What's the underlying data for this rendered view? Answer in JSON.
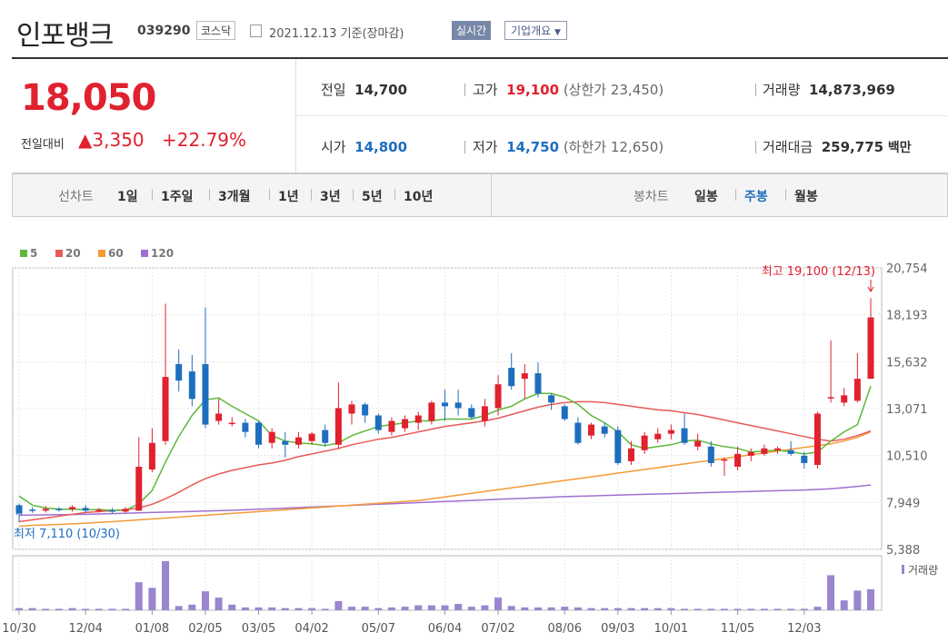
{
  "header": {
    "company": "인포뱅크",
    "code": "039290",
    "market": "코스닥",
    "date": "2021.12.13 기준(장마감)",
    "realtime": "실시간",
    "overview": "기업개요"
  },
  "quote": {
    "price": "18,050",
    "change_label": "전일대비",
    "change_value": "▲3,350",
    "change_pct": "+22.79%",
    "prev_label": "전일",
    "prev_value": "14,700",
    "high_label": "고가",
    "high_value": "19,100",
    "upper_label": "(상한가 23,450)",
    "vol_label": "거래량",
    "vol_value": "14,873,969",
    "open_label": "시가",
    "open_value": "14,800",
    "low_label": "저가",
    "low_value": "14,750",
    "lower_label": "(하한가 12,650)",
    "amt_label": "거래대금",
    "amt_value": "259,775",
    "amt_unit": "백만"
  },
  "tabs": {
    "line_label": "선차트",
    "periods": [
      "1일",
      "1주일",
      "3개월",
      "1년",
      "3년",
      "5년",
      "10년"
    ],
    "candle_label": "봉차트",
    "candles": [
      "일봉",
      "주봉",
      "월봉"
    ],
    "selected": "주봉"
  },
  "colors": {
    "up": "#e0212e",
    "down": "#1e6ebf",
    "ma5": "#5cb83a",
    "ma20": "#e85a58",
    "ma60": "#f59a35",
    "ma120": "#a070d0"
  },
  "chart_data": {
    "type": "candlestick",
    "legend": [
      {
        "name": "5",
        "color": "#5cb83a"
      },
      {
        "name": "20",
        "color": "#e85a58"
      },
      {
        "name": "60",
        "color": "#f59a35"
      },
      {
        "name": "120",
        "color": "#a070d0"
      }
    ],
    "y_ticks": [
      "20,754",
      "18,193",
      "15,632",
      "13,071",
      "10,510",
      "7,949",
      "5,388"
    ],
    "ylim": [
      5388,
      20754
    ],
    "x_ticks": [
      "10/30",
      "12/04",
      "01/08",
      "02/05",
      "03/05",
      "04/02",
      "05/07",
      "06/04",
      "07/02",
      "08/06",
      "09/03",
      "10/01",
      "11/05",
      "12/03"
    ],
    "annotation_high": "최고 19,100 (12/13)",
    "annotation_low": "최저 7,110 (10/30)",
    "volume_label": "거래량",
    "candles": [
      [
        7800,
        7350,
        7900,
        7110
      ],
      [
        7560,
        7500,
        7700,
        7380
      ],
      [
        7500,
        7600,
        7750,
        7400
      ],
      [
        7600,
        7550,
        7700,
        7450
      ],
      [
        7580,
        7700,
        7800,
        7450
      ],
      [
        7650,
        7500,
        7800,
        7400
      ],
      [
        7500,
        7560,
        7650,
        7400
      ],
      [
        7520,
        7450,
        7650,
        7350
      ],
      [
        7450,
        7600,
        7700,
        7400
      ],
      [
        7500,
        9900,
        11500,
        7500
      ],
      [
        9750,
        11200,
        12000,
        9600
      ],
      [
        11300,
        14800,
        18800,
        11100
      ],
      [
        15500,
        14600,
        16300,
        14000
      ],
      [
        15100,
        13600,
        16000,
        13200
      ],
      [
        15500,
        12200,
        18600,
        12000
      ],
      [
        12400,
        12800,
        13600,
        12200
      ],
      [
        12300,
        12300,
        12600,
        12100
      ],
      [
        12300,
        11800,
        12500,
        11500
      ],
      [
        12300,
        11100,
        12400,
        10900
      ],
      [
        11200,
        11800,
        12000,
        10900
      ],
      [
        11300,
        11100,
        11800,
        10400
      ],
      [
        11100,
        11500,
        11800,
        10900
      ],
      [
        11300,
        11700,
        11800,
        11100
      ],
      [
        11900,
        11200,
        12200,
        11000
      ],
      [
        11100,
        13100,
        14500,
        10900
      ],
      [
        12800,
        13300,
        13500,
        12200
      ],
      [
        13300,
        12700,
        13400,
        12300
      ],
      [
        12700,
        11900,
        12800,
        11700
      ],
      [
        11800,
        12400,
        12600,
        11600
      ],
      [
        12000,
        12500,
        12700,
        11800
      ],
      [
        12300,
        12700,
        12900,
        11900
      ],
      [
        12400,
        13400,
        13500,
        12200
      ],
      [
        13400,
        13200,
        14100,
        12400
      ],
      [
        13400,
        13100,
        14100,
        12700
      ],
      [
        13100,
        12600,
        13300,
        12500
      ],
      [
        12400,
        13200,
        13600,
        12100
      ],
      [
        13100,
        14400,
        14900,
        12700
      ],
      [
        15300,
        14300,
        16100,
        14100
      ],
      [
        14700,
        15000,
        15500,
        13600
      ],
      [
        15000,
        13900,
        15600,
        13700
      ],
      [
        13800,
        13400,
        13900,
        13000
      ],
      [
        13200,
        12500,
        13300,
        12400
      ],
      [
        12300,
        11200,
        12600,
        11100
      ],
      [
        11600,
        12200,
        12300,
        11400
      ],
      [
        12100,
        11700,
        12300,
        11500
      ],
      [
        11900,
        10100,
        12100,
        10000
      ],
      [
        10200,
        10900,
        11300,
        10000
      ],
      [
        10800,
        11600,
        11800,
        10600
      ],
      [
        11400,
        11700,
        12000,
        11200
      ],
      [
        11700,
        11900,
        12200,
        11400
      ],
      [
        12000,
        11200,
        12800,
        11100
      ],
      [
        11000,
        11300,
        11700,
        10800
      ],
      [
        11000,
        10100,
        11300,
        9900
      ],
      [
        10300,
        10300,
        10400,
        9400
      ],
      [
        9900,
        10600,
        11000,
        9700
      ],
      [
        10500,
        10700,
        10900,
        10200
      ],
      [
        10600,
        10900,
        11100,
        10500
      ],
      [
        10800,
        10900,
        11000,
        10600
      ],
      [
        10800,
        10600,
        11300,
        10500
      ],
      [
        10500,
        10100,
        10700,
        9800
      ],
      [
        10000,
        12800,
        12900,
        9800
      ],
      [
        13700,
        13700,
        16800,
        13400
      ],
      [
        13400,
        13800,
        14200,
        13200
      ],
      [
        13500,
        14700,
        16100,
        13400
      ],
      [
        14700,
        18050,
        19100,
        14700
      ]
    ],
    "ma5": [
      8300,
      7800,
      7650,
      7580,
      7580,
      7560,
      7560,
      7520,
      7520,
      7880,
      8600,
      10150,
      11550,
      12700,
      13550,
      13650,
      13200,
      12800,
      12400,
      11600,
      11300,
      11200,
      11150,
      11050,
      11200,
      11600,
      11850,
      12100,
      12200,
      12300,
      12400,
      12400,
      12500,
      12500,
      12500,
      12700,
      13000,
      13200,
      13600,
      13900,
      13900,
      13700,
      13300,
      12700,
      12300,
      11800,
      11100,
      10900,
      11000,
      11100,
      11300,
      11350,
      11150,
      11000,
      10900,
      10700,
      10750,
      10800,
      10700,
      10600,
      10700,
      11300,
      11800,
      12200,
      14300
    ],
    "ma20": [
      6900,
      7000,
      7100,
      7200,
      7300,
      7400,
      7450,
      7500,
      7550,
      7650,
      7850,
      8150,
      8500,
      8900,
      9250,
      9500,
      9700,
      9850,
      10000,
      10100,
      10250,
      10450,
      10600,
      10750,
      10900,
      11100,
      11250,
      11400,
      11500,
      11650,
      11800,
      11950,
      12100,
      12200,
      12300,
      12400,
      12550,
      12750,
      12950,
      13150,
      13300,
      13400,
      13450,
      13450,
      13400,
      13300,
      13200,
      13100,
      13000,
      12950,
      12850,
      12750,
      12600,
      12450,
      12300,
      12150,
      12000,
      11850,
      11700,
      11550,
      11400,
      11300,
      11400,
      11600,
      11850
    ],
    "ma60": [
      6650,
      6700,
      6720,
      6750,
      6780,
      6820,
      6860,
      6900,
      6950,
      7000,
      7050,
      7100,
      7150,
      7200,
      7250,
      7300,
      7350,
      7400,
      7450,
      7500,
      7550,
      7600,
      7650,
      7700,
      7750,
      7800,
      7850,
      7900,
      7950,
      8000,
      8050,
      8150,
      8250,
      8350,
      8450,
      8550,
      8650,
      8750,
      8850,
      8950,
      9050,
      9150,
      9250,
      9350,
      9450,
      9550,
      9650,
      9750,
      9850,
      9950,
      10050,
      10150,
      10250,
      10350,
      10450,
      10550,
      10650,
      10750,
      10850,
      10950,
      11050,
      11150,
      11300,
      11500,
      11800
    ],
    "ma120": [
      7250,
      7260,
      7270,
      7280,
      7290,
      7300,
      7320,
      7340,
      7360,
      7380,
      7400,
      7420,
      7440,
      7460,
      7480,
      7500,
      7520,
      7550,
      7580,
      7610,
      7640,
      7670,
      7700,
      7730,
      7760,
      7790,
      7820,
      7850,
      7880,
      7910,
      7940,
      7970,
      8000,
      8030,
      8060,
      8090,
      8120,
      8150,
      8180,
      8210,
      8240,
      8270,
      8290,
      8310,
      8330,
      8350,
      8370,
      8390,
      8410,
      8430,
      8450,
      8470,
      8490,
      8510,
      8530,
      8550,
      8570,
      8590,
      8610,
      8630,
      8660,
      8700,
      8760,
      8830,
      8900
    ],
    "volume": [
      3,
      3,
      2,
      2,
      3,
      2,
      2,
      2,
      2,
      40,
      32,
      70,
      6,
      8,
      27,
      18,
      8,
      4,
      4,
      4,
      3,
      3,
      3,
      2,
      13,
      5,
      5,
      3,
      4,
      5,
      7,
      7,
      7,
      9,
      5,
      7,
      18,
      6,
      4,
      4,
      4,
      5,
      4,
      3,
      3,
      3,
      3,
      3,
      3,
      3,
      2,
      2,
      2,
      2,
      2,
      2,
      2,
      2,
      2,
      2,
      5,
      50,
      14,
      28,
      30
    ]
  }
}
